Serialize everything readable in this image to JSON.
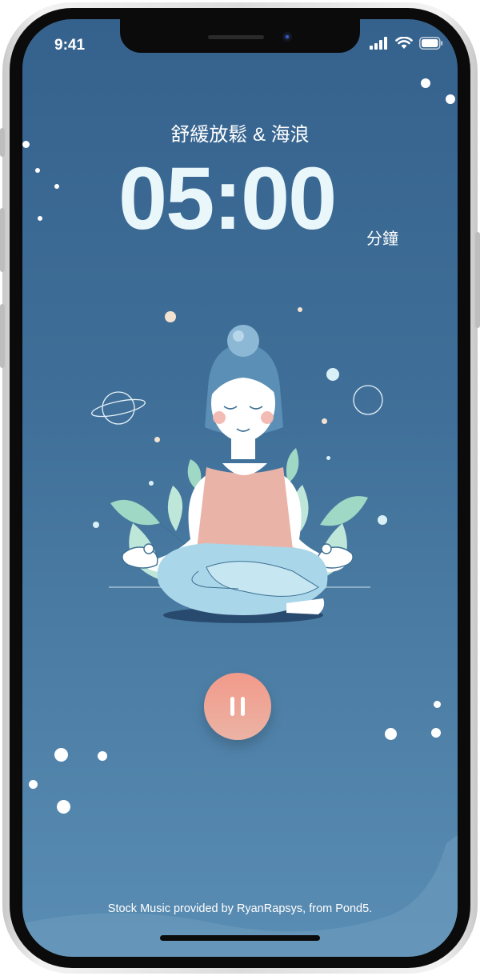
{
  "status_bar": {
    "time": "9:41"
  },
  "track": {
    "title": "舒緩放鬆 & 海浪"
  },
  "timer": {
    "value": "05:00",
    "unit": "分鐘"
  },
  "footer": {
    "credit": "Stock Music provided by RyanRapsys, from Pond5."
  },
  "colors": {
    "background_top": "#35628d",
    "background_bottom": "#5a8db3",
    "accent_button": "#f29a8a",
    "timer_text": "#e9f7fb"
  },
  "icons": [
    "signal-icon",
    "wifi-icon",
    "battery-icon",
    "pause-icon",
    "meditation-illustration"
  ]
}
